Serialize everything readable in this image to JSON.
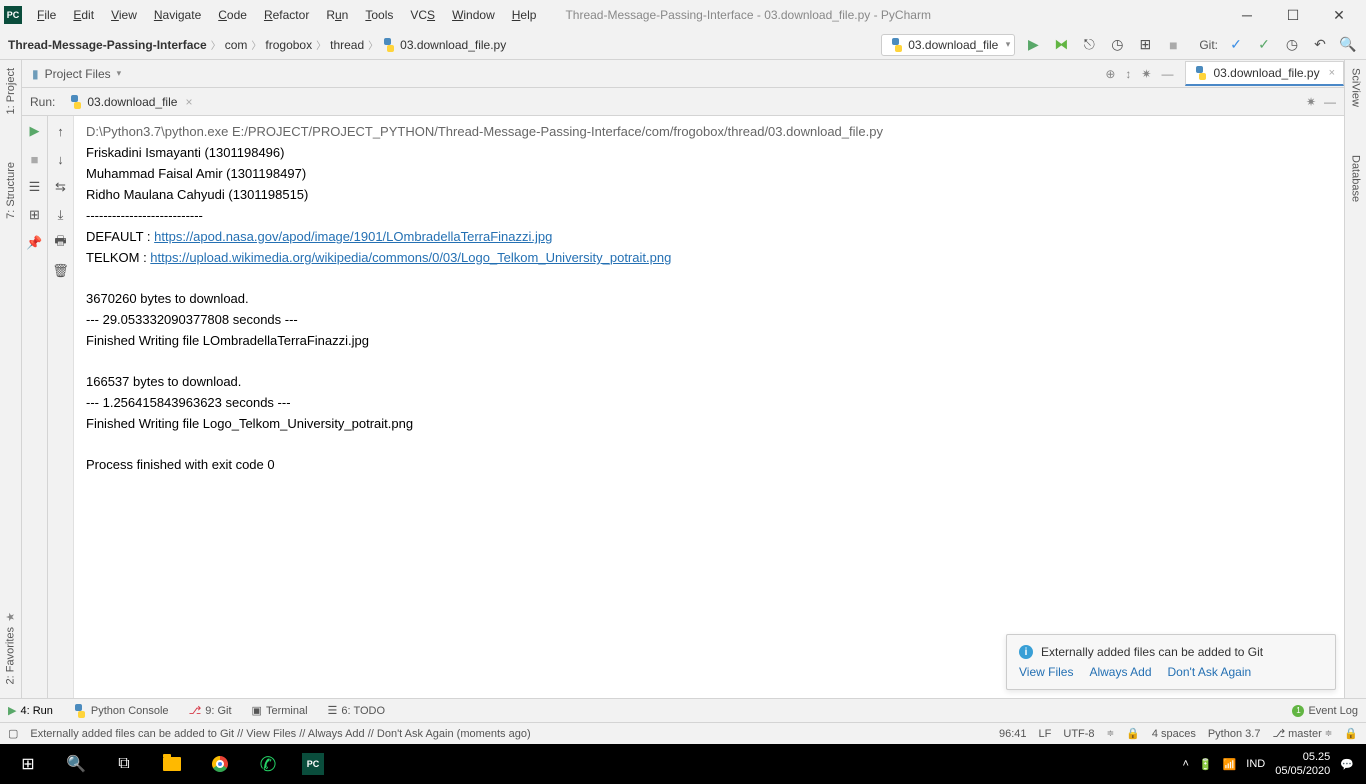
{
  "window": {
    "title": "Thread-Message-Passing-Interface - 03.download_file.py - PyCharm",
    "menu": [
      "File",
      "Edit",
      "View",
      "Navigate",
      "Code",
      "Refactor",
      "Run",
      "Tools",
      "VCS",
      "Window",
      "Help"
    ]
  },
  "breadcrumb": {
    "root": "Thread-Message-Passing-Interface",
    "parts": [
      "com",
      "frogobox",
      "thread",
      "03.download_file.py"
    ]
  },
  "run_config": "03.download_file",
  "git_label": "Git:",
  "project_files_label": "Project Files",
  "editor_tab": "03.download_file.py",
  "run": {
    "label": "Run:",
    "tab": "03.download_file"
  },
  "left_tabs": [
    "1: Project",
    "7: Structure",
    "2: Favorites"
  ],
  "right_tabs": [
    "SciView",
    "Database"
  ],
  "console": {
    "cmd": "D:\\Python3.7\\python.exe E:/PROJECT/PROJECT_PYTHON/Thread-Message-Passing-Interface/com/frogobox/thread/03.download_file.py",
    "l1": "Friskadini Ismayanti (1301198496)",
    "l2": "Muhammad Faisal Amir (1301198497)",
    "l3": "Ridho Maulana Cahyudi (1301198515)",
    "l4": "---------------------------",
    "d_label": "DEFAULT : ",
    "d_url": "https://apod.nasa.gov/apod/image/1901/LOmbradellaTerraFinazzi.jpg",
    "t_label": "TELKOM : ",
    "t_url": "https://upload.wikimedia.org/wikipedia/commons/0/03/Logo_Telkom_University_potrait.png",
    "b1": "3670260 bytes to download.",
    "b2": "--- 29.053332090377808 seconds ---",
    "b3": "Finished Writing file LOmbradellaTerraFinazzi.jpg",
    "c1": "166537 bytes to download.",
    "c2": "--- 1.256415843963623 seconds ---",
    "c3": "Finished Writing file Logo_Telkom_University_potrait.png",
    "exit": "Process finished with exit code 0"
  },
  "notification": {
    "msg": "Externally added files can be added to Git",
    "links": [
      "View Files",
      "Always Add",
      "Don't Ask Again"
    ]
  },
  "bottom_tabs": {
    "run": "4: Run",
    "python_console": "Python Console",
    "git": "9: Git",
    "terminal": "Terminal",
    "todo": "6: TODO",
    "event_log": "Event Log"
  },
  "status": {
    "msg": "Externally added files can be added to Git // View Files // Always Add // Don't Ask Again (moments ago)",
    "pos": "96:41",
    "le": "LF",
    "enc": "UTF-8",
    "indent": "4 spaces",
    "python": "Python 3.7",
    "branch": "master"
  },
  "taskbar": {
    "lang": "IND",
    "time": "05.25",
    "date": "05/05/2020"
  }
}
